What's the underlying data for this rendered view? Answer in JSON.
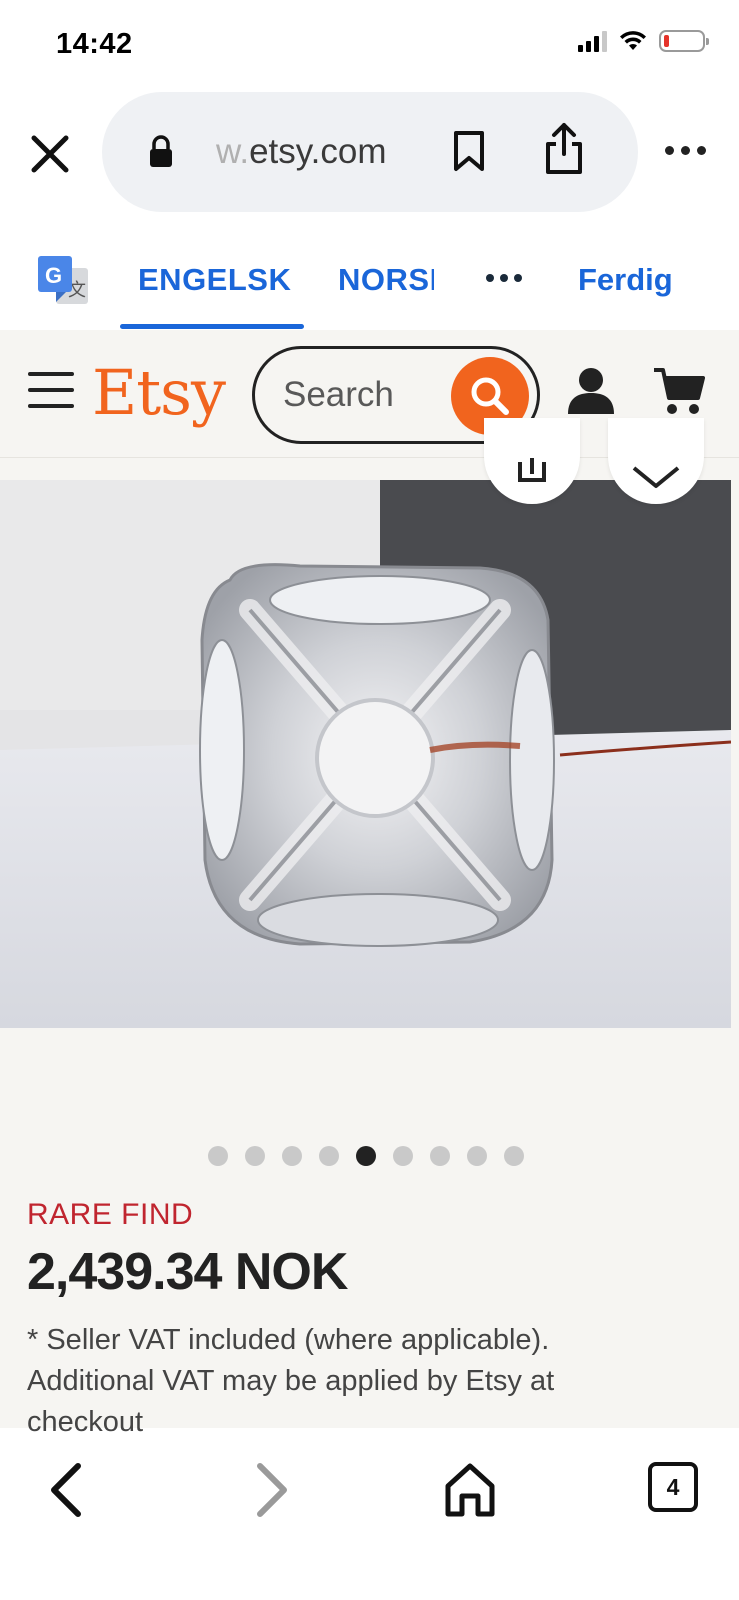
{
  "status_bar": {
    "time": "14:42"
  },
  "browser": {
    "url_prefix": "w.",
    "url_domain": "etsy.com"
  },
  "translate_bar": {
    "tab_active": "ENGELSK",
    "tab_other": "NORSK",
    "done_label": "Ferdig"
  },
  "etsy_header": {
    "logo": "Etsy",
    "search_placeholder": "Search",
    "brand_color": "#f1641e"
  },
  "product": {
    "image_count": 9,
    "active_image_index": 5,
    "badge": "RARE FIND",
    "price": "2,439.34 NOK",
    "vat_note": "* Seller VAT included (where applicable). Additional VAT may be applied by Etsy at checkout"
  },
  "bottom_toolbar": {
    "tab_count": "4"
  }
}
